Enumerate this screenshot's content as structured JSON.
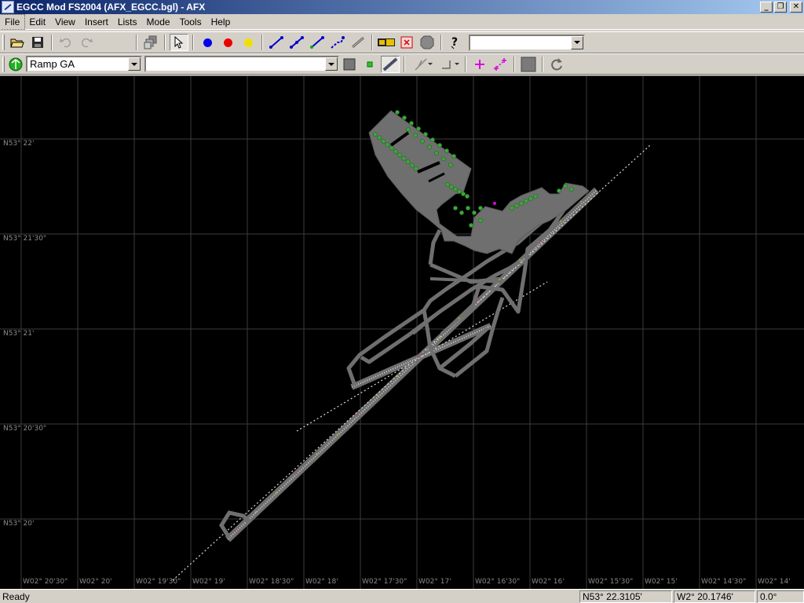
{
  "window": {
    "title": "EGCC Mod FS2004 (AFX_EGCC.bgl) - AFX",
    "minimize_glyph": "_",
    "restore_glyph": "❐",
    "close_glyph": "✕"
  },
  "menu": {
    "items": [
      {
        "label": "File"
      },
      {
        "label": "Edit"
      },
      {
        "label": "View"
      },
      {
        "label": "Insert"
      },
      {
        "label": "Lists"
      },
      {
        "label": "Mode"
      },
      {
        "label": "Tools"
      },
      {
        "label": "Help"
      }
    ]
  },
  "toolbar": {
    "icons": [
      "open-folder-icon",
      "save-disk-icon",
      "undo-icon",
      "redo-icon",
      "layers-icon",
      "select-arrow-icon",
      "blue-point-icon",
      "red-point-icon",
      "yellow-point-icon",
      "taxiway-path-icon",
      "runway-path-icon",
      "parking-path-icon",
      "vehicle-path-icon",
      "edge-line-icon",
      "taxi-sign-icon",
      "exclusion-icon",
      "boundary-polygon-icon",
      "help-icon"
    ],
    "colors": {
      "blue": "#0000ee",
      "red": "#ee0000",
      "yellow": "#f0e000",
      "path": "#0000cc",
      "path_node": "#00aa00",
      "add_cross": "#dd00dd"
    },
    "search_value": ""
  },
  "toolbar2": {
    "parking_type_value": "Ramp GA",
    "second_combo_value": "",
    "icons": [
      "globe-icon",
      "surface-square-icon",
      "green-node-icon",
      "line-edit-icon",
      "bezier-icon",
      "corner-icon",
      "add-node-icon",
      "add-link-icon",
      "fill-square-icon",
      "refresh-icon"
    ]
  },
  "map": {
    "background": "#000000",
    "grid_color": "#3c3c3c",
    "surface_color": "#707070",
    "vegetation_color": "#3ea53e",
    "lat_labels": [
      "N53° 22'",
      "N53° 21'30\"",
      "N53° 21'",
      "N53° 20'30\"",
      "N53° 20'"
    ],
    "lon_labels": [
      "W02° 20'30\"",
      "W02° 20'",
      "W02° 19'30\"",
      "W02° 19'",
      "W02° 18'30\"",
      "W02° 18'",
      "W02° 17'30\"",
      "W02° 17'",
      "W02° 16'30\"",
      "W02° 16'",
      "W02° 15'30\"",
      "W02° 15'",
      "W02° 14'30\"",
      "W02° 14'"
    ]
  },
  "status": {
    "text": "Ready",
    "latitude": "N53° 22.3105'",
    "longitude": "W2° 20.1746'",
    "heading": "0.0°"
  }
}
